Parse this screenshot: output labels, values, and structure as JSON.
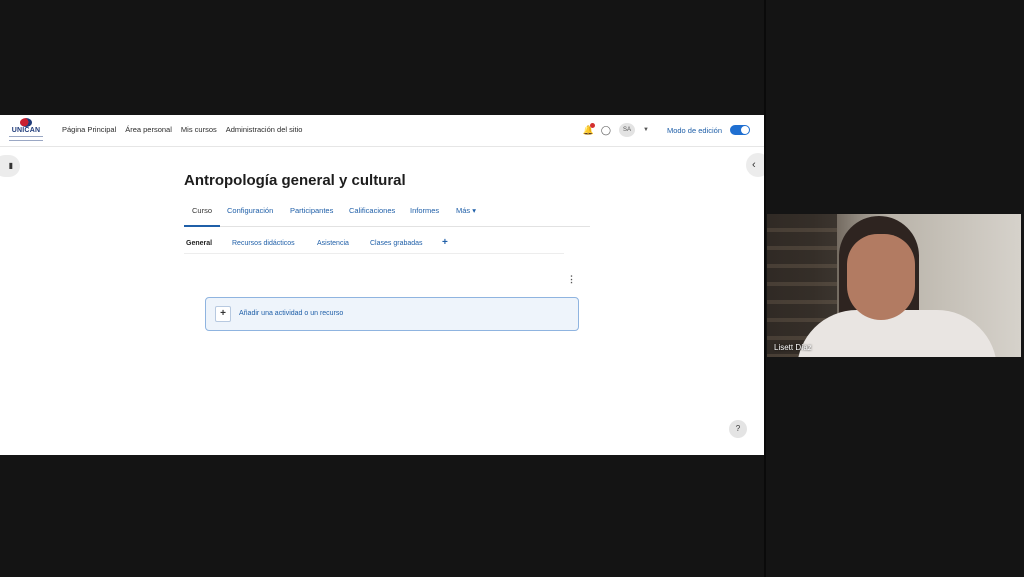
{
  "navbar": {
    "logo_text": "UNICAN",
    "links": [
      "Página Principal",
      "Área personal",
      "Mis cursos",
      "Administración del sitio"
    ],
    "user_initials": "SA",
    "edit_mode_label": "Modo de edición"
  },
  "course": {
    "title": "Antropología general y cultural",
    "tabs": [
      "Curso",
      "Configuración",
      "Participantes",
      "Calificaciones",
      "Informes",
      "Más"
    ],
    "subtabs": [
      "General",
      "Recursos didácticos",
      "Asistencia",
      "Clases grabadas"
    ],
    "add_activity_label": "Añadir una actividad o un recurso"
  },
  "video": {
    "participant_name": "Lisett Díaz"
  },
  "colors": {
    "link": "#1f5fa8",
    "toggle_on": "#1f6fd1",
    "add_box_border": "#8fb4e0"
  },
  "icons": [
    "bell-icon",
    "chat-icon",
    "caret-down-icon",
    "bookmark-icon",
    "chevron-left-icon",
    "plus-icon",
    "kebab-menu-icon",
    "help-icon"
  ]
}
